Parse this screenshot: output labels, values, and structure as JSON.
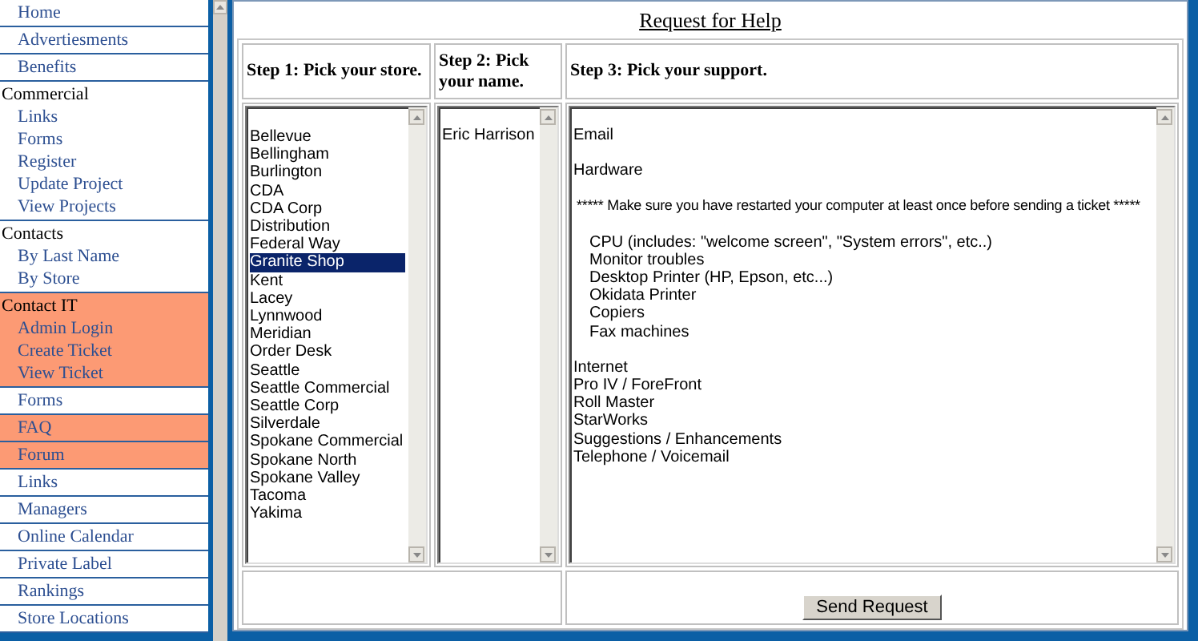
{
  "sidebar": {
    "items": [
      {
        "label": "Home",
        "highlighted": false
      },
      {
        "label": "Advertiesments",
        "highlighted": false
      },
      {
        "label": "Benefits",
        "highlighted": false
      },
      {
        "label": "Commercial",
        "highlighted": false,
        "children": [
          {
            "label": "Links"
          },
          {
            "label": "Forms"
          },
          {
            "label": "Register"
          },
          {
            "label": "Update Project"
          },
          {
            "label": "View Projects"
          }
        ]
      },
      {
        "label": "Contacts",
        "highlighted": false,
        "children": [
          {
            "label": "By Last Name"
          },
          {
            "label": "By Store"
          }
        ]
      },
      {
        "label": "Contact IT",
        "highlighted": true,
        "children": [
          {
            "label": "Admin Login"
          },
          {
            "label": "Create Ticket"
          },
          {
            "label": "View Ticket"
          }
        ]
      },
      {
        "label": "Forms",
        "highlighted": false
      },
      {
        "label": "FAQ",
        "highlighted": true
      },
      {
        "label": "Forum",
        "highlighted": true
      },
      {
        "label": "Links",
        "highlighted": false
      },
      {
        "label": "Managers",
        "highlighted": false
      },
      {
        "label": "Online Calendar",
        "highlighted": false
      },
      {
        "label": "Private Label",
        "highlighted": false
      },
      {
        "label": "Rankings",
        "highlighted": false
      },
      {
        "label": "Store Locations",
        "highlighted": false
      }
    ]
  },
  "page": {
    "title": "Request for Help"
  },
  "steps": [
    {
      "heading": "Step 1: Pick your store."
    },
    {
      "heading": "Step 2: Pick your name."
    },
    {
      "heading": "Step 3: Pick your support."
    }
  ],
  "stores": [
    {
      "label": "Bellevue",
      "selected": false
    },
    {
      "label": "Bellingham",
      "selected": false
    },
    {
      "label": "Burlington",
      "selected": false
    },
    {
      "label": "CDA",
      "selected": false
    },
    {
      "label": "CDA Corp",
      "selected": false
    },
    {
      "label": "Distribution",
      "selected": false
    },
    {
      "label": "Federal Way",
      "selected": false
    },
    {
      "label": "Granite Shop",
      "selected": true
    },
    {
      "label": "Kent",
      "selected": false
    },
    {
      "label": "Lacey",
      "selected": false
    },
    {
      "label": "Lynnwood",
      "selected": false
    },
    {
      "label": "Meridian",
      "selected": false
    },
    {
      "label": "Order Desk",
      "selected": false
    },
    {
      "label": "Seattle",
      "selected": false
    },
    {
      "label": "Seattle Commercial",
      "selected": false
    },
    {
      "label": "Seattle Corp",
      "selected": false
    },
    {
      "label": "Silverdale",
      "selected": false
    },
    {
      "label": "Spokane Commercial",
      "selected": false
    },
    {
      "label": "Spokane North",
      "selected": false
    },
    {
      "label": "Spokane Valley",
      "selected": false
    },
    {
      "label": "Tacoma",
      "selected": false
    },
    {
      "label": "Yakima",
      "selected": false
    }
  ],
  "names": [
    {
      "label": "Eric Harrison",
      "selected": false
    }
  ],
  "support": [
    {
      "kind": "plain",
      "options": [
        {
          "label": "Email",
          "selected": false
        }
      ]
    },
    {
      "kind": "plain",
      "options": [
        {
          "label": "Hardware",
          "selected": false
        }
      ]
    },
    {
      "kind": "notice",
      "options": [
        {
          "label": "***** Make sure you have restarted your computer at least once before sending a ticket *****",
          "selected": false
        }
      ]
    },
    {
      "kind": "sub",
      "options": [
        {
          "label": "CPU (includes: \"welcome screen\", \"System errors\", etc..)",
          "selected": false
        },
        {
          "label": "Monitor troubles",
          "selected": false
        },
        {
          "label": "Desktop Printer (HP, Epson, etc...)",
          "selected": false
        },
        {
          "label": "Okidata Printer",
          "selected": false
        },
        {
          "label": "Copiers",
          "selected": false
        },
        {
          "label": "Fax machines",
          "selected": false
        }
      ]
    },
    {
      "kind": "plain",
      "options": [
        {
          "label": "Internet",
          "selected": false
        },
        {
          "label": "Pro IV / ForeFront",
          "selected": false
        },
        {
          "label": "Roll Master",
          "selected": false
        },
        {
          "label": "StarWorks",
          "selected": false
        },
        {
          "label": "Suggestions / Enhancements",
          "selected": false
        },
        {
          "label": "Telephone / Voicemail",
          "selected": false
        }
      ]
    }
  ],
  "submit": {
    "label": "Send Request"
  }
}
